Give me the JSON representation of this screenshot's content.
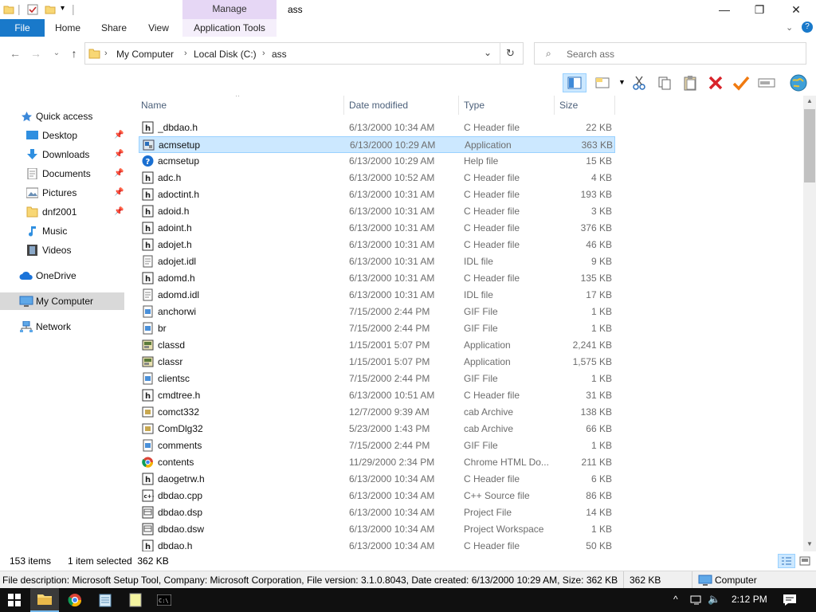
{
  "window": {
    "title": "ass",
    "manage_tab": "Manage",
    "minimize": "—",
    "maximize": "❐",
    "close": "✕"
  },
  "ribbon": {
    "file": "File",
    "tabs": [
      "Home",
      "Share",
      "View"
    ],
    "app_tools": "Application Tools"
  },
  "address": {
    "crumbs": [
      "My Computer",
      "Local Disk (C:)",
      "ass"
    ],
    "search_placeholder": "Search ass"
  },
  "nav": {
    "items": [
      {
        "label": "Quick access",
        "icon": "star-icon"
      },
      {
        "label": "Desktop",
        "icon": "desktop-icon",
        "pinned": true
      },
      {
        "label": "Downloads",
        "icon": "download-icon",
        "pinned": true
      },
      {
        "label": "Documents",
        "icon": "document-icon",
        "pinned": true
      },
      {
        "label": "Pictures",
        "icon": "picture-icon",
        "pinned": true
      },
      {
        "label": "dnf2001",
        "icon": "folder-icon",
        "pinned": true
      },
      {
        "label": "Music",
        "icon": "music-icon"
      },
      {
        "label": "Videos",
        "icon": "video-icon"
      },
      {
        "label": "OneDrive",
        "icon": "cloud-icon"
      },
      {
        "label": "My Computer",
        "icon": "computer-icon",
        "selected": true
      },
      {
        "label": "Network",
        "icon": "network-icon"
      }
    ]
  },
  "columns": {
    "name": "Name",
    "date": "Date modified",
    "type": "Type",
    "size": "Size"
  },
  "files": [
    {
      "name": "_dbdao.h",
      "date": "6/13/2000 10:34 AM",
      "type": "C Header file",
      "size": "22 KB",
      "icon": "h"
    },
    {
      "name": "acmsetup",
      "date": "6/13/2000 10:29 AM",
      "type": "Application",
      "size": "363 KB",
      "icon": "app",
      "selected": true
    },
    {
      "name": "acmsetup",
      "date": "6/13/2000 10:29 AM",
      "type": "Help file",
      "size": "15 KB",
      "icon": "help"
    },
    {
      "name": "adc.h",
      "date": "6/13/2000 10:52 AM",
      "type": "C Header file",
      "size": "4 KB",
      "icon": "h"
    },
    {
      "name": "adoctint.h",
      "date": "6/13/2000 10:31 AM",
      "type": "C Header file",
      "size": "193 KB",
      "icon": "h"
    },
    {
      "name": "adoid.h",
      "date": "6/13/2000 10:31 AM",
      "type": "C Header file",
      "size": "3 KB",
      "icon": "h"
    },
    {
      "name": "adoint.h",
      "date": "6/13/2000 10:31 AM",
      "type": "C Header file",
      "size": "376 KB",
      "icon": "h"
    },
    {
      "name": "adojet.h",
      "date": "6/13/2000 10:31 AM",
      "type": "C Header file",
      "size": "46 KB",
      "icon": "h"
    },
    {
      "name": "adojet.idl",
      "date": "6/13/2000 10:31 AM",
      "type": "IDL file",
      "size": "9 KB",
      "icon": "txt"
    },
    {
      "name": "adomd.h",
      "date": "6/13/2000 10:31 AM",
      "type": "C Header file",
      "size": "135 KB",
      "icon": "h"
    },
    {
      "name": "adomd.idl",
      "date": "6/13/2000 10:31 AM",
      "type": "IDL file",
      "size": "17 KB",
      "icon": "txt"
    },
    {
      "name": "anchorwi",
      "date": "7/15/2000 2:44 PM",
      "type": "GIF File",
      "size": "1 KB",
      "icon": "gif"
    },
    {
      "name": "br",
      "date": "7/15/2000 2:44 PM",
      "type": "GIF File",
      "size": "1 KB",
      "icon": "gif"
    },
    {
      "name": "classd",
      "date": "1/15/2001 5:07 PM",
      "type": "Application",
      "size": "2,241 KB",
      "icon": "exe"
    },
    {
      "name": "classr",
      "date": "1/15/2001 5:07 PM",
      "type": "Application",
      "size": "1,575 KB",
      "icon": "exe"
    },
    {
      "name": "clientsc",
      "date": "7/15/2000 2:44 PM",
      "type": "GIF File",
      "size": "1 KB",
      "icon": "gif"
    },
    {
      "name": "cmdtree.h",
      "date": "6/13/2000 10:51 AM",
      "type": "C Header file",
      "size": "31 KB",
      "icon": "h"
    },
    {
      "name": "comct332",
      "date": "12/7/2000 9:39 AM",
      "type": "cab Archive",
      "size": "138 KB",
      "icon": "cab"
    },
    {
      "name": "ComDlg32",
      "date": "5/23/2000 1:43 PM",
      "type": "cab Archive",
      "size": "66 KB",
      "icon": "cab"
    },
    {
      "name": "comments",
      "date": "7/15/2000 2:44 PM",
      "type": "GIF File",
      "size": "1 KB",
      "icon": "gif"
    },
    {
      "name": "contents",
      "date": "11/29/2000 2:34 PM",
      "type": "Chrome HTML Do...",
      "size": "211 KB",
      "icon": "chrome"
    },
    {
      "name": "daogetrw.h",
      "date": "6/13/2000 10:34 AM",
      "type": "C Header file",
      "size": "6 KB",
      "icon": "h"
    },
    {
      "name": "dbdao.cpp",
      "date": "6/13/2000 10:34 AM",
      "type": "C++ Source file",
      "size": "86 KB",
      "icon": "cpp"
    },
    {
      "name": "dbdao.dsp",
      "date": "6/13/2000 10:34 AM",
      "type": "Project File",
      "size": "14 KB",
      "icon": "proj"
    },
    {
      "name": "dbdao.dsw",
      "date": "6/13/2000 10:34 AM",
      "type": "Project Workspace",
      "size": "1 KB",
      "icon": "proj"
    },
    {
      "name": "dbdao.h",
      "date": "6/13/2000 10:34 AM",
      "type": "C Header file",
      "size": "50 KB",
      "icon": "h"
    }
  ],
  "status": {
    "items": "153 items",
    "selected": "1 item selected  362 KB"
  },
  "description": {
    "text": "File description: Microsoft Setup Tool, Company: Microsoft Corporation, File version: 3.1.0.8043, Date created: 6/13/2000 10:29 AM, Size: 362 KB",
    "size": "362 KB",
    "location": "Computer"
  },
  "taskbar": {
    "time": "2:12 PM"
  },
  "colors": {
    "accent": "#1979ca",
    "selection": "#cce8ff",
    "manage": "#e6d7f5"
  }
}
